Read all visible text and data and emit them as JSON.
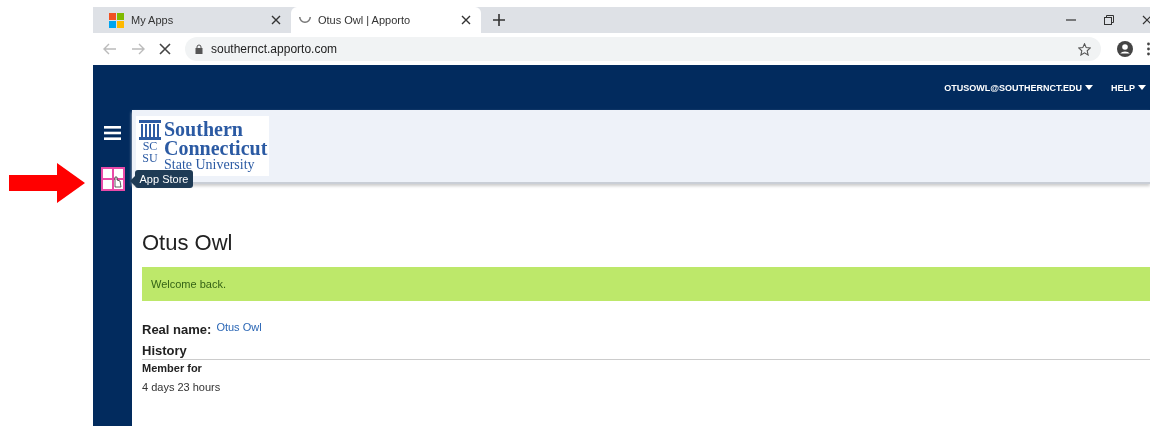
{
  "annotation": {
    "kind": "arrow"
  },
  "browser": {
    "tabs": [
      {
        "title": "My Apps",
        "selected": false,
        "kind": "tiles"
      },
      {
        "title": "Otus Owl | Apporto",
        "selected": true,
        "kind": "loading"
      }
    ],
    "address": "southernct.apporto.com"
  },
  "header": {
    "menus": [
      "OTUSOWL@SOUTHERNCT.EDU",
      "HELP"
    ]
  },
  "logo": {
    "monogram_top": "SC",
    "monogram_bottom": "SU",
    "lines": [
      "Southern",
      "Connecticut",
      "State University"
    ]
  },
  "sidebar": {
    "items": [
      {
        "kind": "menu"
      },
      {
        "kind": "app-store",
        "tooltip": "App Store"
      }
    ]
  },
  "profile": {
    "title": "Otus Owl",
    "message": "Welcome back.",
    "real_name_label": "Real name:",
    "real_name": "Otus Owl",
    "history_heading": "History",
    "member_label": "Member for",
    "member_value": "4 days 23 hours"
  }
}
